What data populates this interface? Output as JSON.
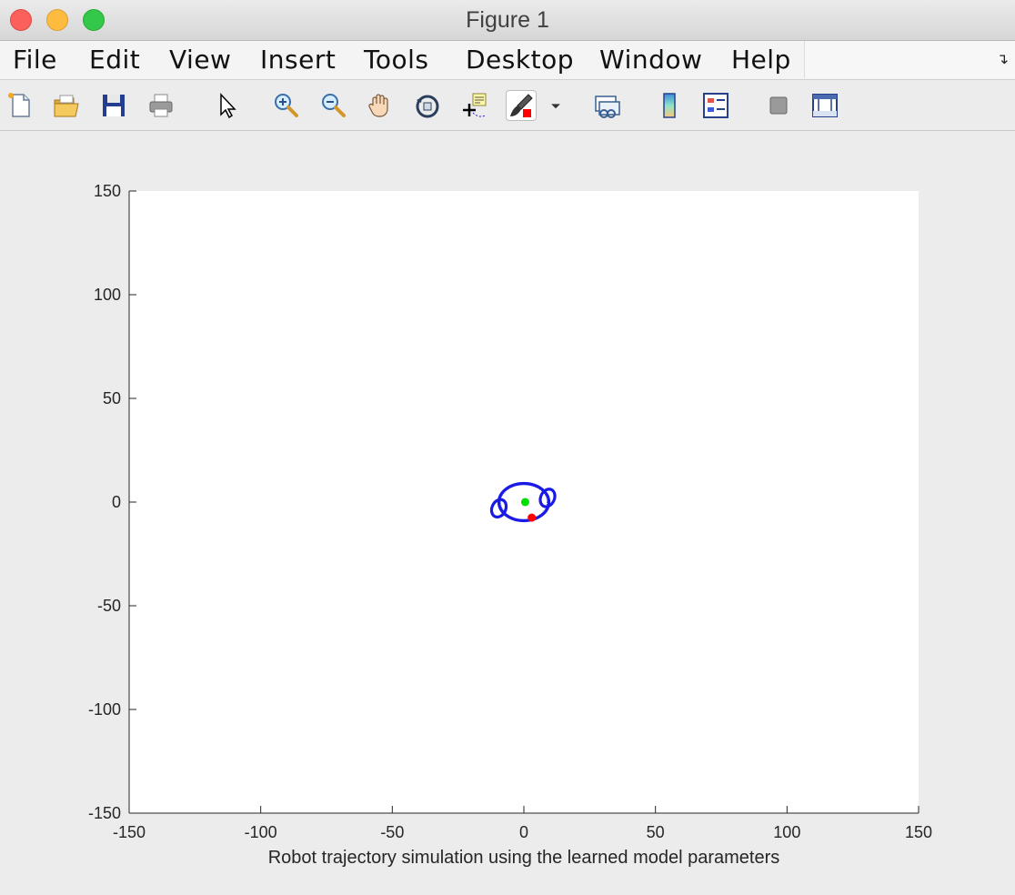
{
  "window": {
    "title": "Figure 1"
  },
  "menu": {
    "items": [
      "File",
      "Edit",
      "View",
      "Insert",
      "Tools",
      "Desktop",
      "Window",
      "Help"
    ]
  },
  "toolbar": {
    "buttons": [
      {
        "name": "new-figure",
        "icon": "new-file-icon"
      },
      {
        "name": "open-file",
        "icon": "folder-open-icon"
      },
      {
        "name": "save-figure",
        "icon": "save-icon"
      },
      {
        "name": "print-figure",
        "icon": "printer-icon"
      },
      {
        "name": "edit-plot",
        "icon": "pointer-arrow-icon"
      },
      {
        "name": "zoom-in",
        "icon": "zoom-in-icon"
      },
      {
        "name": "zoom-out",
        "icon": "zoom-out-icon"
      },
      {
        "name": "pan",
        "icon": "hand-icon"
      },
      {
        "name": "rotate-3d",
        "icon": "rotate-icon"
      },
      {
        "name": "data-cursor",
        "icon": "data-cursor-icon"
      },
      {
        "name": "brush",
        "icon": "brush-icon"
      },
      {
        "name": "brush-dropdown",
        "icon": "dropdown-arrow-icon"
      },
      {
        "name": "link-plot",
        "icon": "link-plot-icon"
      },
      {
        "name": "insert-colorbar",
        "icon": "colorbar-icon"
      },
      {
        "name": "insert-legend",
        "icon": "legend-icon"
      },
      {
        "name": "hide-plot-tools",
        "icon": "hide-tools-icon"
      },
      {
        "name": "show-plot-tools",
        "icon": "show-tools-icon"
      }
    ]
  },
  "chart_data": {
    "type": "scatter",
    "title": "",
    "xlabel": "Robot trajectory simulation using the learned model parameters",
    "ylabel": "",
    "xlim": [
      -150,
      150
    ],
    "ylim": [
      -150,
      150
    ],
    "xticks": [
      -150,
      -100,
      -50,
      0,
      50,
      100,
      150
    ],
    "yticks": [
      -150,
      -100,
      -50,
      0,
      50,
      100,
      150
    ],
    "xtick_labels": [
      "-150",
      "-100",
      "-50",
      "0",
      "50",
      "100",
      "150"
    ],
    "ytick_labels": [
      "-150",
      "-100",
      "-50",
      "0",
      "50",
      "100",
      "150"
    ],
    "grid": false,
    "colors": {
      "trajectory": "#1a1ae6",
      "start": "#00e000",
      "end": "#ff0000"
    },
    "shapes": [
      {
        "kind": "ellipse",
        "cx": 0,
        "cy": 0,
        "rx": 9.5,
        "ry": 9,
        "color": "#1a1ae6"
      },
      {
        "kind": "ellipse",
        "cx": 9,
        "cy": 2,
        "rx": 2.6,
        "ry": 4.4,
        "rotate": 25,
        "color": "#1a1ae6"
      },
      {
        "kind": "ellipse",
        "cx": -9.5,
        "cy": -3,
        "rx": 2.6,
        "ry": 4.4,
        "rotate": 25,
        "color": "#1a1ae6"
      }
    ],
    "markers": [
      {
        "x": 0.5,
        "y": 0,
        "color": "#00e000"
      },
      {
        "x": 3,
        "y": -7.5,
        "color": "#ff0000"
      }
    ]
  }
}
